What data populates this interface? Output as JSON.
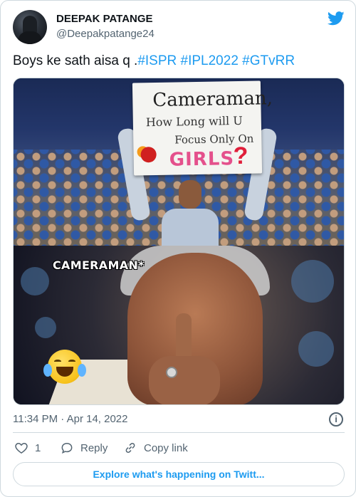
{
  "author": {
    "name": "DEEPAK PATANGE",
    "handle": "@Deepakpatange24"
  },
  "tweet": {
    "text_prefix": "Boys ke sath aisa q .",
    "hashtags": [
      "#ISPR",
      "#IPL2022",
      "#GTvRR"
    ]
  },
  "media": {
    "top_panel": {
      "sign_line1": "Cameraman,",
      "sign_line2": "How Long will U",
      "sign_line3": "Focus Only On",
      "sign_line4": "GIRLS",
      "sign_mark": "?"
    },
    "bottom_panel": {
      "caption": "CAMERAMAN*"
    }
  },
  "meta": {
    "timestamp": "11:34 PM · Apr 14, 2022"
  },
  "actions": {
    "like_count": "1",
    "reply_label": "Reply",
    "copy_link_label": "Copy link"
  },
  "footer": {
    "explore_label": "Explore what's happening on Twitt..."
  },
  "colors": {
    "accent": "#1d9bf0",
    "text_primary": "#0f1419",
    "text_secondary": "#536471",
    "border": "#cfd9de"
  },
  "icons": {
    "brand": "twitter-bird-icon",
    "info": "info-icon",
    "like": "heart-icon",
    "reply": "reply-bubble-icon",
    "copy_link": "link-icon"
  }
}
